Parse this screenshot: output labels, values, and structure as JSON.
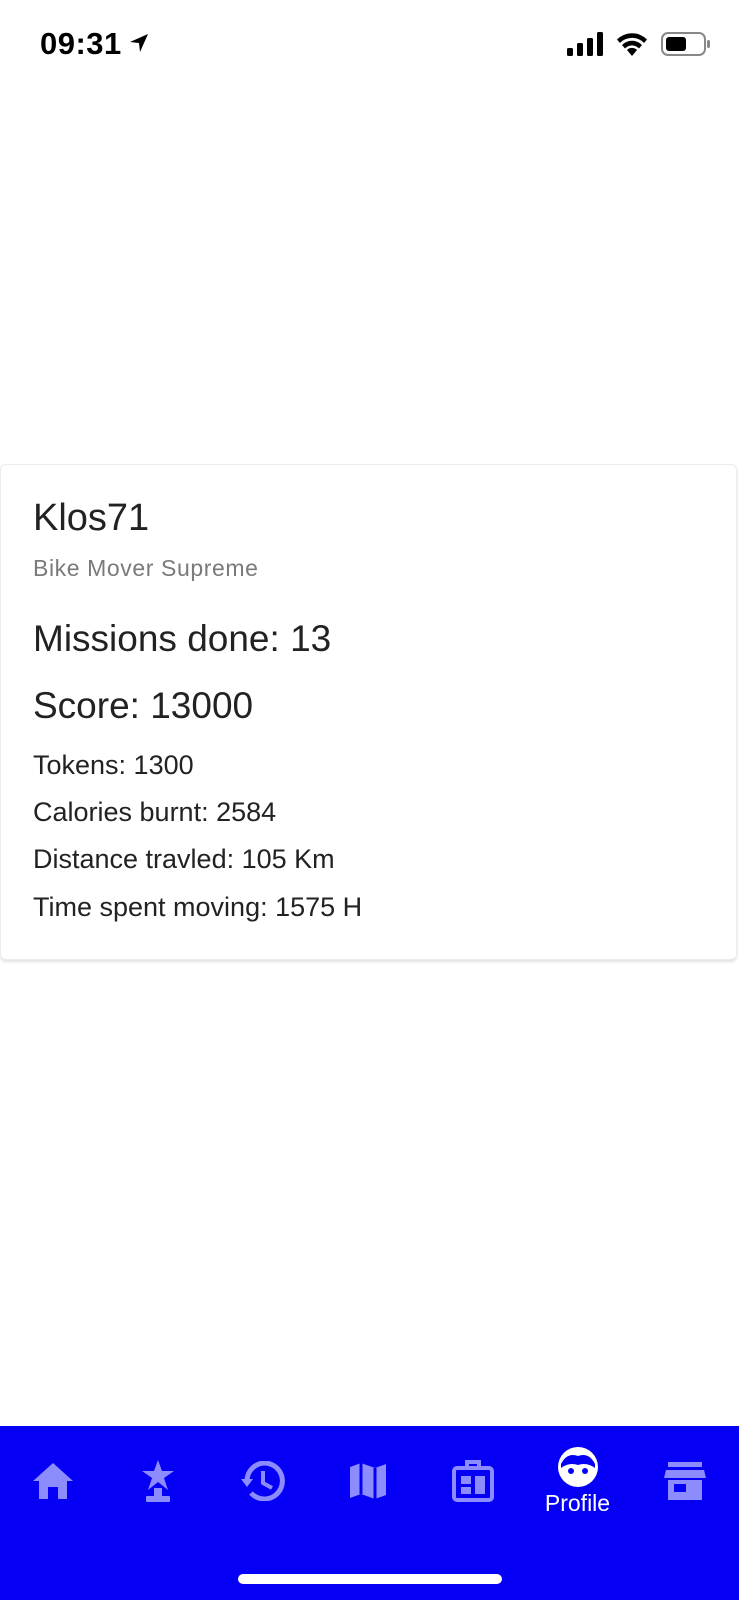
{
  "status_bar": {
    "time": "09:31",
    "icons": [
      "location-arrow-icon",
      "cellular-signal-icon",
      "wifi-icon",
      "battery-icon"
    ]
  },
  "profile": {
    "username": "Klos71",
    "rank": "Bike Mover Supreme",
    "missions": "Missions done: 13",
    "score": "Score: 13000",
    "tokens": "Tokens: 1300",
    "calories": "Calories burnt: 2584",
    "distance": "Distance travled: 105 Km",
    "time_moving": "Time spent moving: 1575 H"
  },
  "bottom_nav": {
    "background": "#0500f5",
    "inactive_icon_color": "#8c8cff",
    "active_color": "#ffffff",
    "items": [
      {
        "icon": "home-icon",
        "label": ""
      },
      {
        "icon": "award-icon",
        "label": ""
      },
      {
        "icon": "history-icon",
        "label": ""
      },
      {
        "icon": "map-icon",
        "label": ""
      },
      {
        "icon": "dashboard-icon",
        "label": ""
      },
      {
        "icon": "face-icon",
        "label": "Profile",
        "active": true
      },
      {
        "icon": "store-icon",
        "label": ""
      }
    ]
  }
}
